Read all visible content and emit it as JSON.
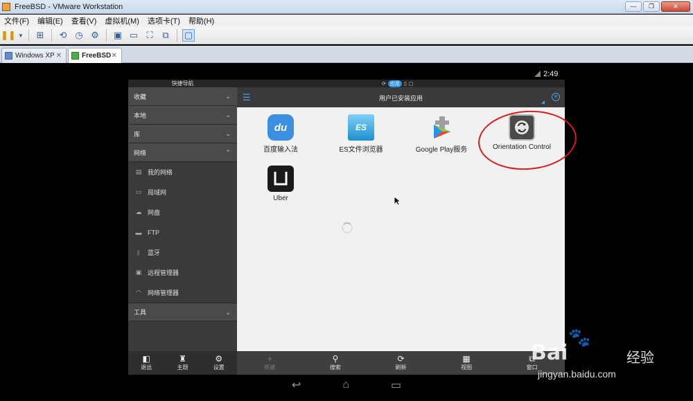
{
  "window": {
    "title": "FreeBSD - VMware Workstation"
  },
  "menubar": [
    "文件(F)",
    "编辑(E)",
    "查看(V)",
    "虚拟机(M)",
    "选项卡(T)",
    "帮助(H)"
  ],
  "tabs": [
    {
      "label": "Windows XP",
      "active": false
    },
    {
      "label": "FreeBSD",
      "active": true
    }
  ],
  "android": {
    "clock": "2:49",
    "status_center": "应用",
    "sidebar": {
      "title": "快捷导航",
      "categories": [
        "收藏",
        "本地",
        "库",
        "网络"
      ],
      "network_items": [
        "我的网络",
        "局域网",
        "网盘",
        "FTP",
        "蓝牙",
        "远程管理器",
        "网络管理器"
      ],
      "tools": "工具",
      "bottom_buttons": [
        "退出",
        "主题",
        "设置"
      ]
    },
    "header_title": "用户已安装应用",
    "apps": [
      {
        "label": "百度输入法",
        "icon": "baidu-input-icon"
      },
      {
        "label": "ES文件浏览器",
        "icon": "es-file-explorer-icon"
      },
      {
        "label": "Google Play服务",
        "icon": "google-play-services-icon"
      },
      {
        "label": "Orientation Control",
        "icon": "orientation-control-icon"
      },
      {
        "label": "Uber",
        "icon": "uber-icon"
      }
    ],
    "bottom_bar": [
      "新建",
      "搜索",
      "刷新",
      "视图",
      "窗口"
    ]
  },
  "watermark": {
    "brand": "Bai",
    "sub": "经验",
    "url": "jingyan.baidu.com"
  }
}
